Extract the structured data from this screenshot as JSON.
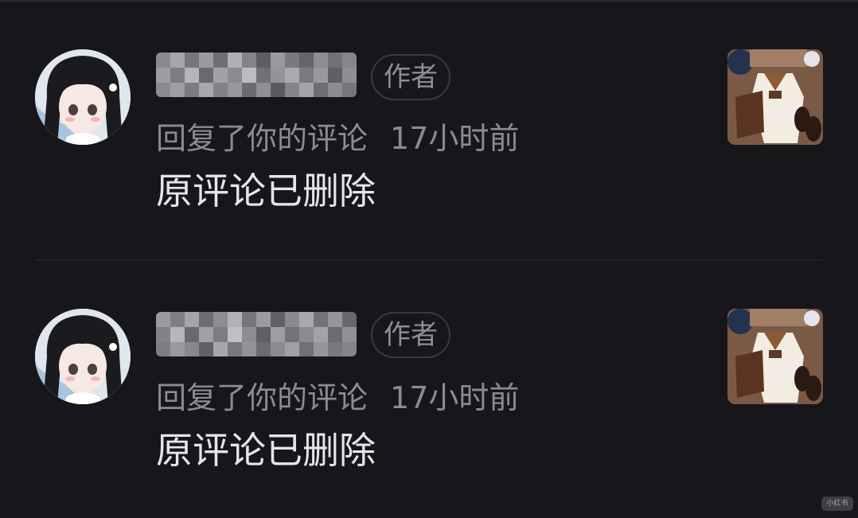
{
  "notifications": [
    {
      "username": "",
      "author_badge": "作者",
      "action": "回复了你的评论",
      "time": "17小时前",
      "comment": "原评论已删除"
    },
    {
      "username": "",
      "author_badge": "作者",
      "action": "回复了你的评论",
      "time": "17小时前",
      "comment": "原评论已删除"
    }
  ],
  "watermark": "小红书",
  "colors": {
    "background": "#17161b",
    "meta_text": "#8c8b91",
    "comment_text": "#e6e6e8",
    "badge_border": "#3a3940",
    "divider": "#2c2b31"
  },
  "icons": {
    "avatar": "anime-girl-avatar",
    "post_thumbnail": "outfit-flatlay-thumbnail"
  }
}
